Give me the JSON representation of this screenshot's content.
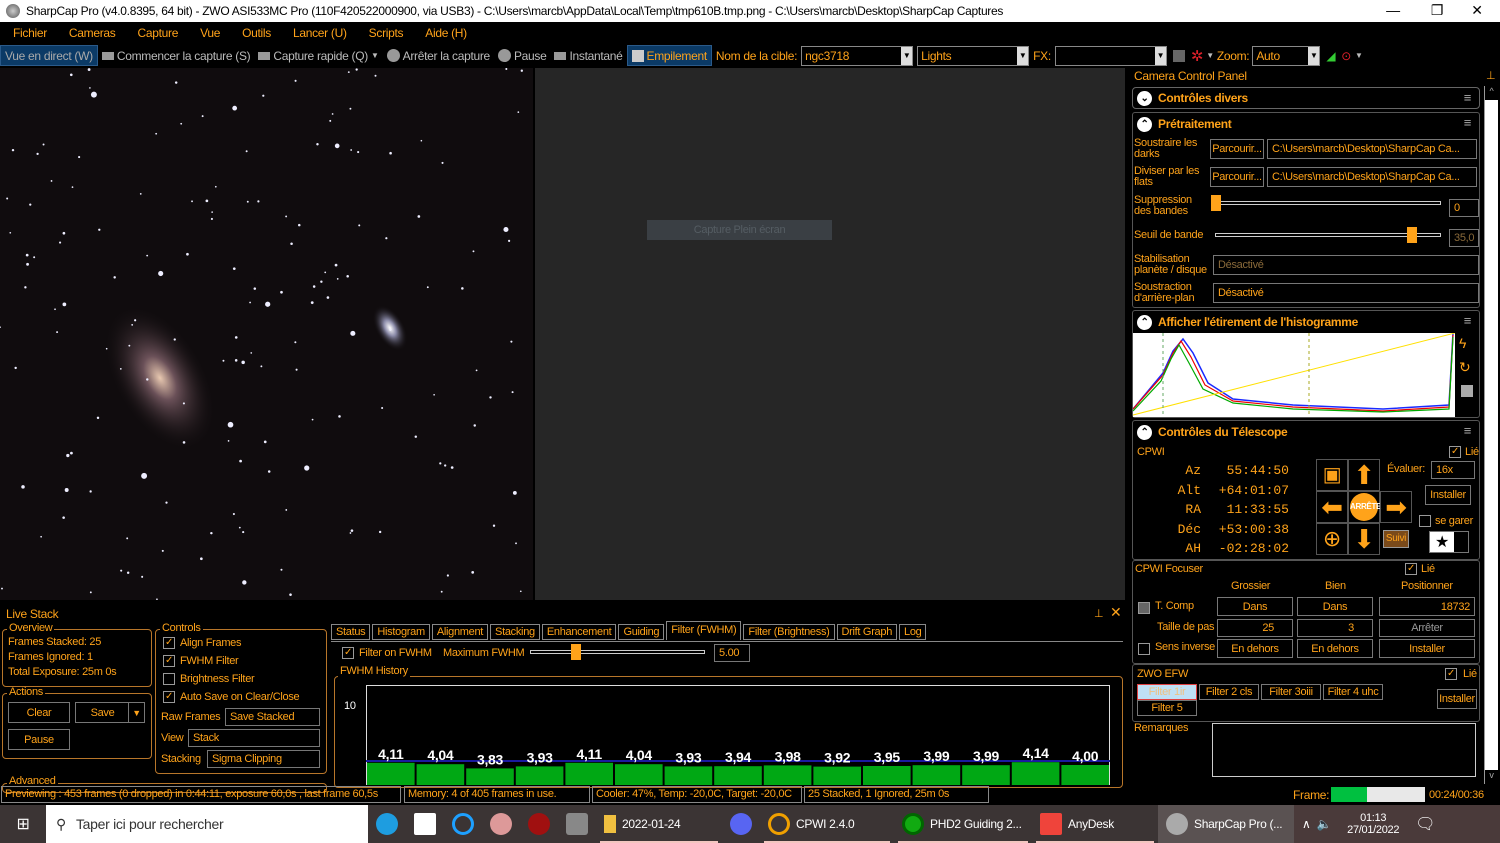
{
  "title": "SharpCap Pro (v4.0.8395, 64 bit) - ZWO ASI533MC Pro (110F420522000900, via USB3) - C:\\Users\\marcb\\AppData\\Local\\Temp\\tmp610B.tmp.png - C:\\Users\\marcb\\Desktop\\SharpCap Captures",
  "menu": [
    "Fichier",
    "Cameras",
    "Capture",
    "Vue",
    "Outils",
    "Lancer (U)",
    "Scripts",
    "Aide (H)"
  ],
  "toolbar": {
    "live": "Vue en direct (W)",
    "start": "Commencer la capture (S)",
    "quick": "Capture rapide (Q)",
    "stop": "Arrêter la capture",
    "pause": "Pause",
    "snapshot": "Instantané",
    "stacking": "Empilement",
    "target_label": "Nom de la cible:",
    "target": "ngc3718",
    "frame_type": "Lights",
    "fx_label": "FX:",
    "fx": "",
    "zoom_label": "Zoom:",
    "zoom": "Auto"
  },
  "viewer": {
    "fullscreen": "Capture Plein écran"
  },
  "ccp": {
    "title": "Camera Control Panel",
    "misc": "Contrôles divers",
    "pre": {
      "title": "Prétraitement",
      "darks_label": "Soustraire les darks",
      "browse": "Parcourir...",
      "darks_path": "C:\\Users\\marcb\\Desktop\\SharpCap Ca...",
      "flats_label": "Diviser par les flats",
      "flats_path": "C:\\Users\\marcb\\Desktop\\SharpCap Ca...",
      "banding_label": "Suppression des bandes",
      "banding": "0",
      "threshold_label": "Seuil de bande",
      "threshold": "35,0",
      "planet_label": "Stabilisation planète / disque",
      "planet": "Désactivé",
      "bg_label": "Soustraction d'arrière-plan",
      "bg": "Désactivé"
    },
    "hist": {
      "title": "Afficher l'étirement de l'histogramme"
    },
    "tel": {
      "title": "Contrôles du Télescope",
      "mount": "CPWI",
      "linked": "Lié",
      "rows": [
        [
          "Az",
          "55:44:50"
        ],
        [
          "Alt",
          "+64:01:07"
        ],
        [
          "RA",
          "11:33:55"
        ],
        [
          "Déc",
          "+53:00:38"
        ],
        [
          "AH",
          "-02:28:02"
        ]
      ],
      "stop": "ARRÊTE",
      "rate_label": "Évaluer:",
      "rate": "16x",
      "setup": "Installer",
      "park": "se garer",
      "track": "Suivi"
    },
    "focuser": {
      "title": "CPWI Focuser",
      "linked": "Lié",
      "coarse": "Grossier",
      "fine": "Bien",
      "position_label": "Positionner",
      "tcomp": "T. Comp",
      "in": "Dans",
      "position": "18732",
      "step_label": "Taille de pas",
      "coarse_step": "25",
      "fine_step": "3",
      "stop": "Arrêter",
      "reverse": "Sens inverse",
      "out": "En dehors",
      "setup": "Installer"
    },
    "efw": {
      "title": "ZWO EFW",
      "linked": "Lié",
      "filters": [
        "Filter 1ir",
        "Filter 2 cls",
        "Filter 3oiii",
        "Filter 4 uhc",
        "Filter 5"
      ],
      "setup": "Installer"
    },
    "notes_label": "Remarques"
  },
  "stack": {
    "title": "Live Stack",
    "overview": "Overview",
    "stacked": "Frames Stacked:  25",
    "ignored": "Frames Ignored:  1",
    "exposure": "Total Exposure:    25m 0s",
    "actions": "Actions",
    "clear": "Clear",
    "save": "Save",
    "pause": "Pause",
    "advanced": "Advanced",
    "controls": "Controls",
    "align": "Align Frames",
    "fwhm": "FWHM Filter",
    "bright": "Brightness Filter",
    "autosave": "Auto Save on Clear/Close",
    "raw_label": "Raw Frames",
    "raw": "Save Stacked",
    "view_label": "View",
    "view": "Stack",
    "stacking_label": "Stacking",
    "stacking": "Sigma Clipping",
    "tabs": [
      "Status",
      "Histogram",
      "Alignment",
      "Stacking",
      "Enhancement",
      "Guiding",
      "Filter (FWHM)",
      "Filter (Brightness)",
      "Drift Graph",
      "Log"
    ],
    "filter_on": "Filter on FWHM",
    "max_label": "Maximum FWHM",
    "max": "5.00",
    "history": "FWHM History"
  },
  "chart_data": {
    "type": "bar",
    "ytick": "10",
    "values": [
      "4,11",
      "4,04",
      "3,83",
      "3,93",
      "4,11",
      "4,04",
      "3,93",
      "3,94",
      "3,98",
      "3,92",
      "3,95",
      "3,99",
      "3,99",
      "4,14",
      "4,00"
    ],
    "threshold": 5.0,
    "bar_color": "#00a814"
  },
  "status": {
    "preview": "Previewing : 453 frames (0 dropped) in 0:44:11, exposure 60,0s , last frame 60,5s",
    "memory": "Memory: 4 of 405 frames in use.",
    "cooler": "Cooler: 47%, Temp: -20,0C, Target: -20,0C",
    "stack": "25 Stacked, 1 Ignored, 25m 0s",
    "frame_label": "Frame:",
    "frame_progress": 0.38,
    "frame_time": "00:24/00:36"
  },
  "taskbar": {
    "search": "Taper ici pour rechercher",
    "folder": "2022-01-24",
    "cpwi": "CPWI 2.4.0",
    "phd": "PHD2 Guiding 2...",
    "anydesk": "AnyDesk",
    "sharpcap": "SharpCap Pro (...",
    "time": "01:13",
    "date": "27/01/2022"
  }
}
